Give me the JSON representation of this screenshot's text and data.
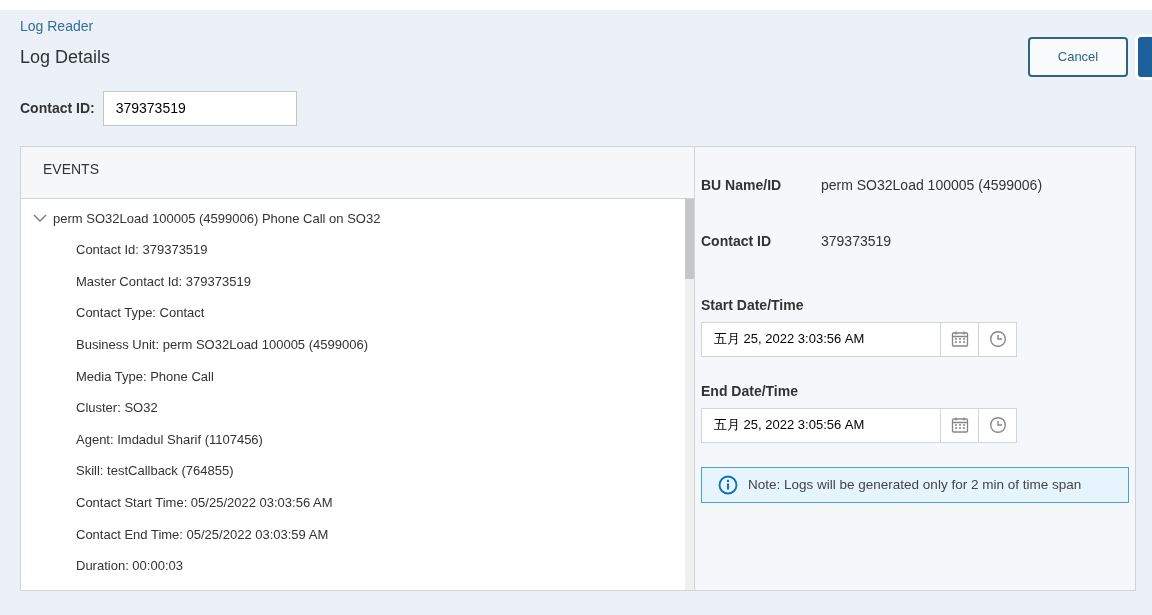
{
  "breadcrumb": "Log Reader",
  "title": "Log Details",
  "buttons": [
    {
      "label": "Cancel",
      "kind": "outline"
    },
    {
      "kind": "primary"
    }
  ],
  "contact_field": {
    "label": "Contact ID:",
    "value": "379373519"
  },
  "events": {
    "heading": "EVENTS",
    "tree": [
      {
        "label": "perm SO32Load 100005 (4599006) Phone Call on SO32",
        "expanded": true,
        "children": [
          {
            "label": "Contact Id: 379373519"
          },
          {
            "label": "Master Contact Id: 379373519"
          },
          {
            "label": "Contact Type: Contact"
          },
          {
            "label": "Business Unit: perm SO32Load 100005 (4599006)"
          },
          {
            "label": "Media Type: Phone Call"
          },
          {
            "label": "Cluster: SO32"
          },
          {
            "label": "Agent: Imdadul Sharif (1107456)"
          },
          {
            "label": "Skill: testCallback (764855)"
          },
          {
            "label": "Contact Start Time: 05/25/2022 03:03:56 AM"
          },
          {
            "label": "Contact End Time: 05/25/2022 03:03:59 AM"
          },
          {
            "label": "Duration: 00:00:03"
          }
        ]
      }
    ]
  },
  "details": [
    {
      "label": "BU Name/ID",
      "value": "perm SO32Load 100005 (4599006)"
    },
    {
      "label": "Contact ID",
      "value": "379373519"
    }
  ],
  "date_fields": [
    {
      "label": "Start Date/Time",
      "value": "五月 25, 2022 3:03:56 AM"
    },
    {
      "label": "End Date/Time",
      "value": "五月 25, 2022 3:05:56 AM"
    }
  ],
  "note": "Note: Logs will be generated only for 2 min of time span"
}
